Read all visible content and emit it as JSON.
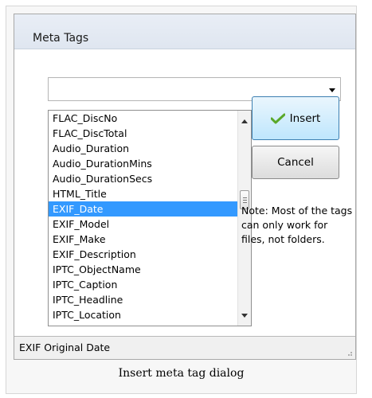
{
  "dialog": {
    "title": "Meta Tags",
    "combo_value": "",
    "list_items": [
      "FLAC_DiscNo",
      "FLAC_DiscTotal",
      "Audio_Duration",
      "Audio_DurationMins",
      "Audio_DurationSecs",
      "HTML_Title",
      "EXIF_Date",
      "EXIF_Model",
      "EXIF_Make",
      "EXIF_Description",
      "IPTC_ObjectName",
      "IPTC_Caption",
      "IPTC_Headline",
      "IPTC_Location"
    ],
    "selected_index": 6,
    "buttons": {
      "insert_label": "Insert",
      "cancel_label": "Cancel"
    },
    "note": "Note: Most of the tags can only work for files, not folders.",
    "status": "EXIF Original Date"
  },
  "caption": "Insert meta tag dialog",
  "icons": {
    "insert": "check-icon",
    "combo": "chevron-down-icon"
  },
  "colors": {
    "selection": "#3399ff",
    "insert_border": "#3c7fb1"
  }
}
